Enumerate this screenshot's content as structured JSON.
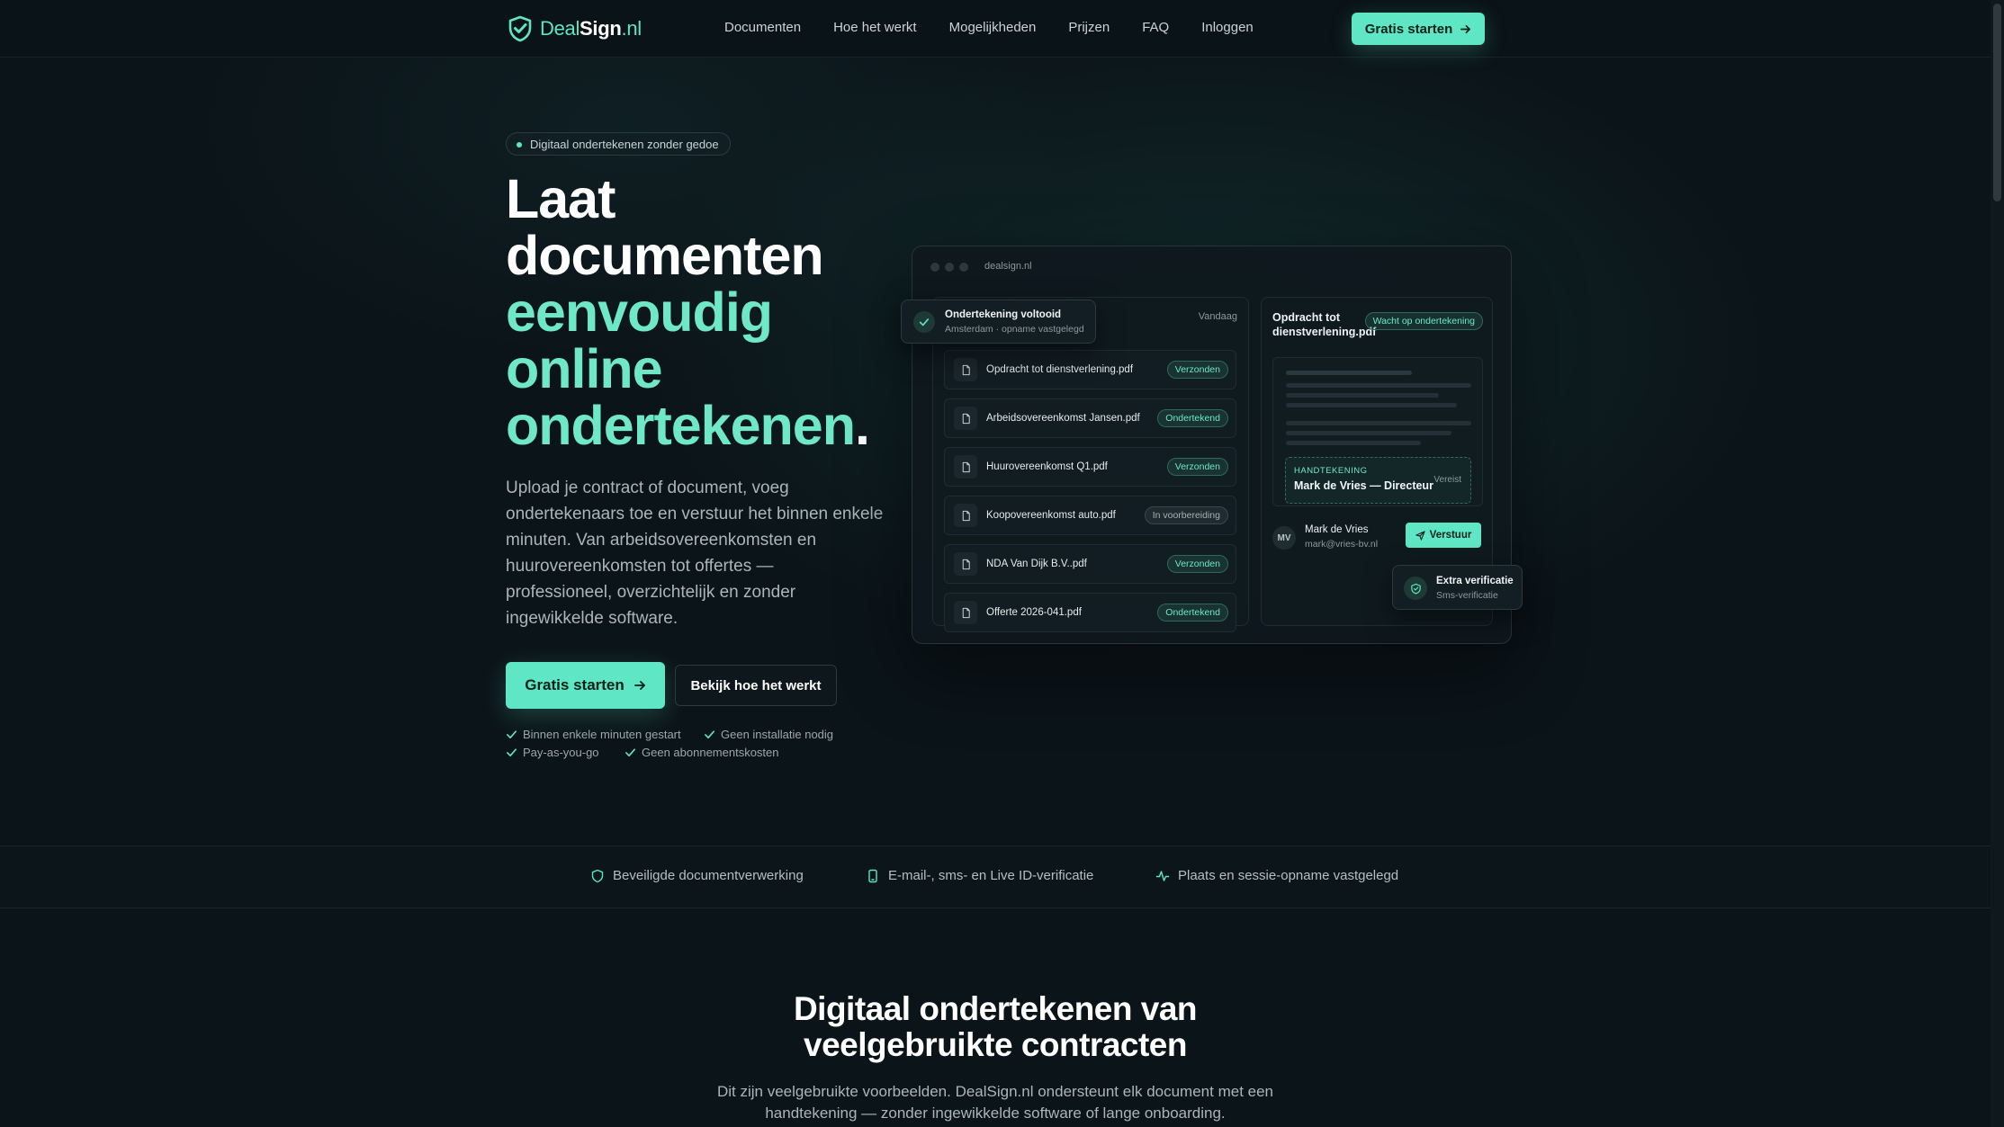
{
  "nav": {
    "logo": {
      "deal": "Deal",
      "sign": "Sign",
      "nl": ".nl"
    },
    "links": [
      "Documenten",
      "Hoe het werkt",
      "Mogelijkheden",
      "Prijzen",
      "FAQ",
      "Inloggen"
    ],
    "cta": "Gratis starten"
  },
  "hero": {
    "badge": "Digitaal ondertekenen zonder gedoe",
    "headline_white": [
      "Laat",
      "documenten"
    ],
    "headline_green": [
      "eenvoudig",
      "online",
      "ondertekenen"
    ],
    "headline_period": ".",
    "intro": "Upload je contract of document, voeg ondertekenaars toe en verstuur het binnen enkele minuten. Van arbeidsovereenkomsten en huurovereenkomsten tot offertes — professioneel, overzichtelijk en zonder ingewikkelde software.",
    "primary_button": "Gratis starten",
    "secondary_button": "Bekijk hoe het werkt",
    "checks": [
      "Binnen enkele minuten gestart",
      "Geen installatie nodig",
      "Pay-as-you-go",
      "Geen abonnementskosten"
    ]
  },
  "mockup": {
    "url": "dealsign.nl",
    "today": "Vandaag",
    "toast": {
      "title": "Ondertekening voltooid",
      "subtitle": "Amsterdam · opname vastgelegd"
    },
    "documents": [
      {
        "name": "Opdracht tot dienstverlening.pdf",
        "status": "Verzonden",
        "tone": "green"
      },
      {
        "name": "Arbeidsovereenkomst Jansen.pdf",
        "status": "Ondertekend",
        "tone": "green"
      },
      {
        "name": "Huurovereenkomst Q1.pdf",
        "status": "Verzonden",
        "tone": "green"
      },
      {
        "name": "Koopovereenkomst auto.pdf",
        "status": "In voorbereiding",
        "tone": "grey"
      },
      {
        "name": "NDA Van Dijk B.V..pdf",
        "status": "Verzonden",
        "tone": "green"
      },
      {
        "name": "Offerte 2026-041.pdf",
        "status": "Ondertekend",
        "tone": "green"
      }
    ],
    "detail": {
      "title": "Opdracht tot dienstverlening.pdf",
      "status": "Wacht op ondertekening",
      "signature_label": "HANDTEKENING",
      "signature_name": "Mark de Vries — Directeur",
      "signature_required": "Vereist",
      "signer_initials": "MV",
      "signer_name": "Mark de Vries",
      "signer_email": "mark@vries-bv.nl",
      "send_button": "Verstuur"
    },
    "verification": {
      "title": "Extra verificatie",
      "subtitle": "Sms-verificatie"
    }
  },
  "trust": [
    "Beveiligde documentverwerking",
    "E-mail-, sms- en Live ID-verificatie",
    "Plaats en sessie-opname vastgelegd"
  ],
  "section": {
    "title_line1": "Digitaal ondertekenen van",
    "title_line2": "veelgebruikte contracten",
    "subtitle": "Dit zijn veelgebruikte voorbeelden. DealSign.nl ondersteunt elk document met een handtekening — zonder ingewikkelde software of lange onboarding."
  },
  "colors": {
    "accent": "#5ee6c5",
    "background": "#0b1419",
    "headline_green": "#6ee8c8"
  }
}
